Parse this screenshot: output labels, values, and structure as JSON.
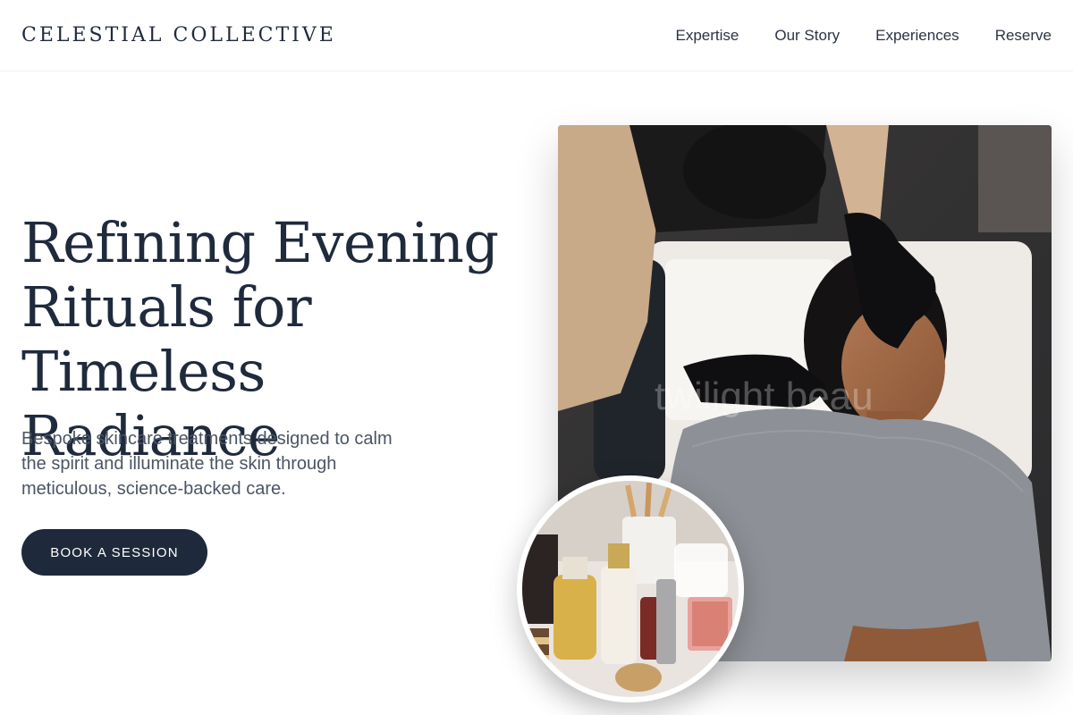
{
  "brand": {
    "name": "CELESTIAL COLLECTIVE"
  },
  "nav": {
    "items": [
      {
        "label": "Expertise"
      },
      {
        "label": "Our Story"
      },
      {
        "label": "Experiences"
      },
      {
        "label": "Reserve"
      }
    ]
  },
  "hero": {
    "title_lines": [
      "Refining Evening",
      "Rituals for",
      "Timeless Radiance"
    ],
    "subtitle": "Bespoke skincare treatments designed to calm the spirit and illuminate the skin through meticulous, science-backed care.",
    "cta_label": "BOOK A SESSION",
    "photo_watermark": "twilight beau"
  },
  "colors": {
    "primary": "#1e293b",
    "text": "#1f2a3c",
    "muted": "#4b5563",
    "background": "#ffffff"
  },
  "icons": {
    "hero_photo": "facial-treatment-photo",
    "product_photo": "skincare-products-photo"
  }
}
